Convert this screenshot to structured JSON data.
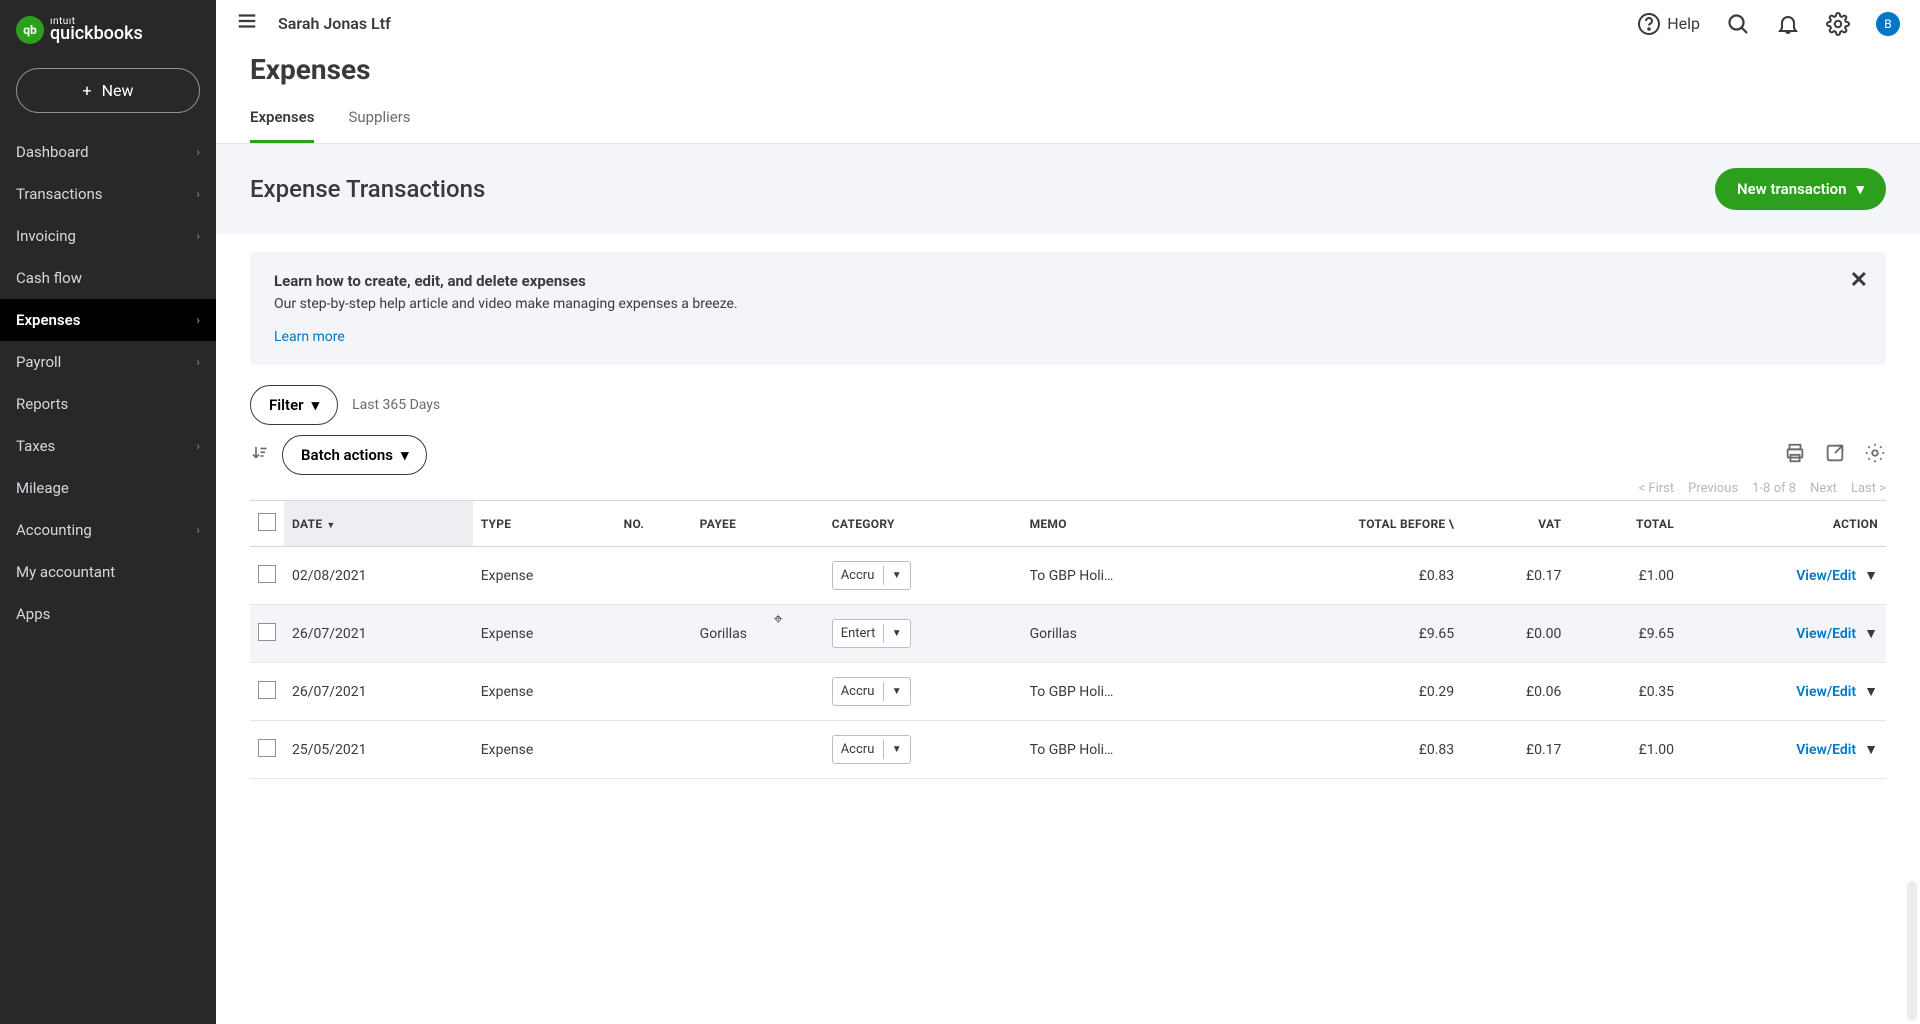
{
  "brand": {
    "intuit": "ıntuıt",
    "product": "quickbooks",
    "badge": "qb"
  },
  "newButton": "New",
  "nav": {
    "items": [
      {
        "label": "Dashboard",
        "chev": true
      },
      {
        "label": "Transactions",
        "chev": true
      },
      {
        "label": "Invoicing",
        "chev": true
      },
      {
        "label": "Cash flow",
        "chev": false
      },
      {
        "label": "Expenses",
        "chev": true,
        "active": true
      },
      {
        "label": "Payroll",
        "chev": true
      },
      {
        "label": "Reports",
        "chev": false
      },
      {
        "label": "Taxes",
        "chev": true
      },
      {
        "label": "Mileage",
        "chev": false
      },
      {
        "label": "Accounting",
        "chev": true
      },
      {
        "label": "My accountant",
        "chev": false
      },
      {
        "label": "Apps",
        "chev": false
      }
    ]
  },
  "topbar": {
    "company": "Sarah Jonas Ltf",
    "help": "Help",
    "avatar": "B"
  },
  "page": {
    "title": "Expenses",
    "tabs": [
      {
        "label": "Expenses",
        "active": true
      },
      {
        "label": "Suppliers",
        "active": false
      }
    ],
    "sectionTitle": "Expense Transactions",
    "newTransaction": "New transaction"
  },
  "info": {
    "heading": "Learn how to create, edit, and delete expenses",
    "body": "Our step-by-step help article and video make managing expenses a breeze.",
    "link": "Learn more"
  },
  "controls": {
    "filter": "Filter",
    "range": "Last 365 Days",
    "batch": "Batch actions"
  },
  "pager": {
    "first": "< First",
    "prev": "Previous",
    "range": "1-8 of 8",
    "next": "Next",
    "last": "Last >"
  },
  "columns": {
    "date": "DATE",
    "type": "TYPE",
    "no": "NO.",
    "payee": "PAYEE",
    "category": "CATEGORY",
    "memo": "MEMO",
    "totalBefore": "TOTAL BEFORE \\",
    "vat": "VAT",
    "total": "TOTAL",
    "action": "ACTION"
  },
  "actionLabel": "View/Edit",
  "rows": [
    {
      "date": "02/08/2021",
      "type": "Expense",
      "no": "",
      "payee": "",
      "category": "Accru",
      "memo": "To GBP Holi…",
      "before": "£0.83",
      "vat": "£0.17",
      "total": "£1.00"
    },
    {
      "date": "26/07/2021",
      "type": "Expense",
      "no": "",
      "payee": "Gorillas",
      "category": "Entert",
      "memo": "Gorillas",
      "before": "£9.65",
      "vat": "£0.00",
      "total": "£9.65",
      "hover": true
    },
    {
      "date": "26/07/2021",
      "type": "Expense",
      "no": "",
      "payee": "",
      "category": "Accru",
      "memo": "To GBP Holi…",
      "before": "£0.29",
      "vat": "£0.06",
      "total": "£0.35"
    },
    {
      "date": "25/05/2021",
      "type": "Expense",
      "no": "",
      "payee": "",
      "category": "Accru",
      "memo": "To GBP Holi…",
      "before": "£0.83",
      "vat": "£0.17",
      "total": "£1.00"
    }
  ]
}
